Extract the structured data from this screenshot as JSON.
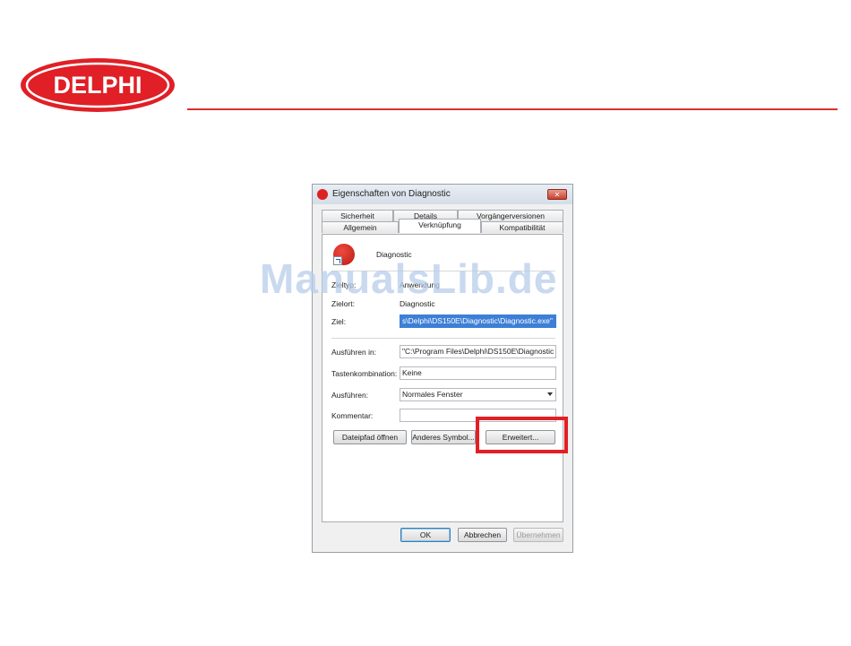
{
  "brand": {
    "logo_text": "DELPHI",
    "accent_color": "#d6322f"
  },
  "dialog": {
    "title": "Eigenschaften von Diagnostic",
    "close_symbol": "✕",
    "tabs_back": [
      "Sicherheit",
      "Details",
      "Vorgängerversionen"
    ],
    "tabs_front": [
      "Allgemein",
      "Verknüpfung",
      "Kompatibilität"
    ],
    "active_tab": "Verknüpfung",
    "app_name": "Diagnostic",
    "fields": {
      "type_label": "Zieltyp:",
      "type_value": "Anwendung",
      "location_label": "Zielort:",
      "location_value": "Diagnostic",
      "target_label": "Ziel:",
      "target_value": "s\\Delphi\\DS150E\\Diagnostic\\Diagnostic.exe\"",
      "start_in_label": "Ausführen in:",
      "start_in_value": "\"C:\\Program Files\\Delphi\\DS150E\\Diagnostic",
      "shortcut_key_label": "Tastenkombination:",
      "shortcut_key_value": "Keine",
      "run_label": "Ausführen:",
      "run_value": "Normales Fenster",
      "comment_label": "Kommentar:",
      "comment_value": ""
    },
    "buttons": {
      "open_location": "Dateipfad öffnen",
      "change_icon": "Anderes Symbol...",
      "advanced": "Erweitert...",
      "ok": "OK",
      "cancel": "Abbrechen",
      "apply": "Übernehmen"
    }
  },
  "watermark": "ManualsLib.de",
  "highlight_color": "#e31e24"
}
